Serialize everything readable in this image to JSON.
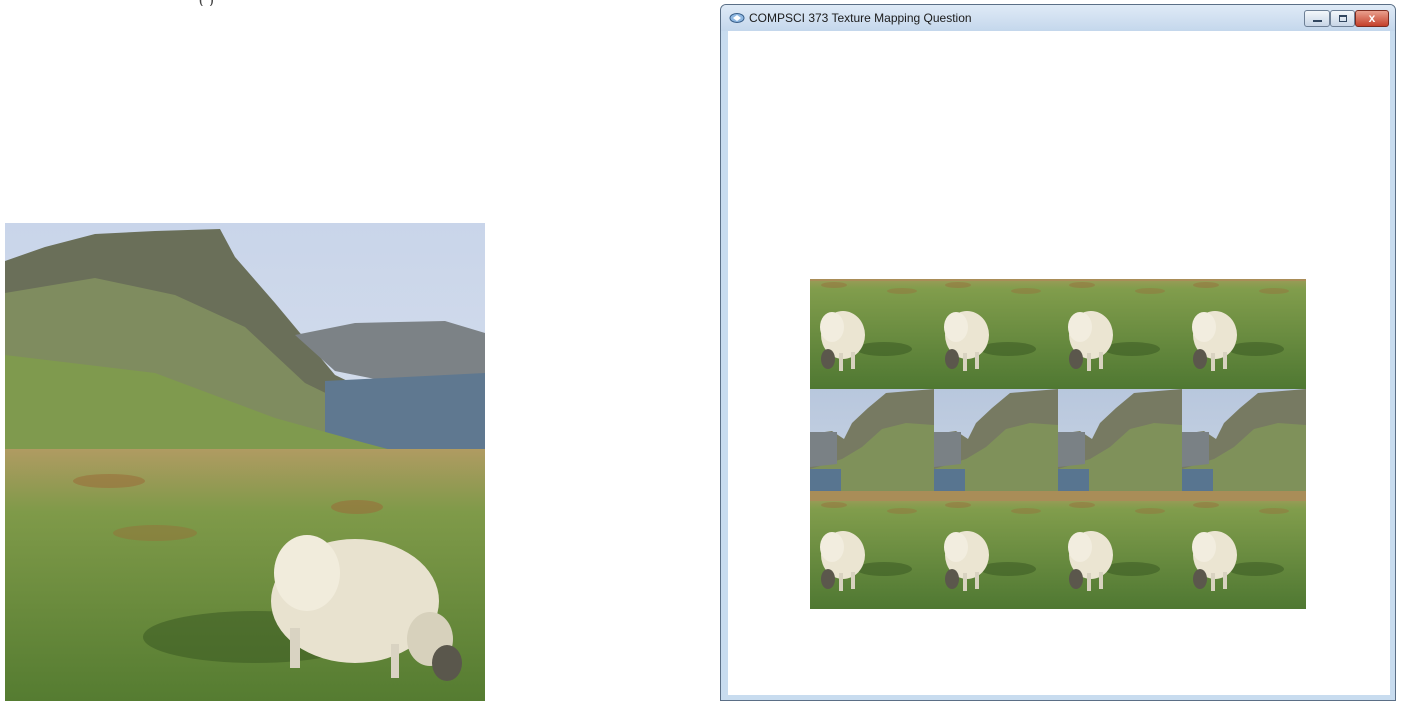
{
  "page": {
    "top_fragment": "(     )"
  },
  "source_image": {
    "description_icon": "sheep-texture-image"
  },
  "window": {
    "title": "COMPSCI 373 Texture Mapping Question",
    "app_icon": "app-icon",
    "controls": {
      "minimize_icon": "minimize-icon",
      "maximize_icon": "maximize-icon",
      "close_label": "x"
    },
    "texture_grid": {
      "columns": 4,
      "rows": 2.5
    }
  },
  "colors": {
    "titlebar": "#c4d7ec",
    "close_button": "#c4402a",
    "window_border": "#5b6f86"
  }
}
